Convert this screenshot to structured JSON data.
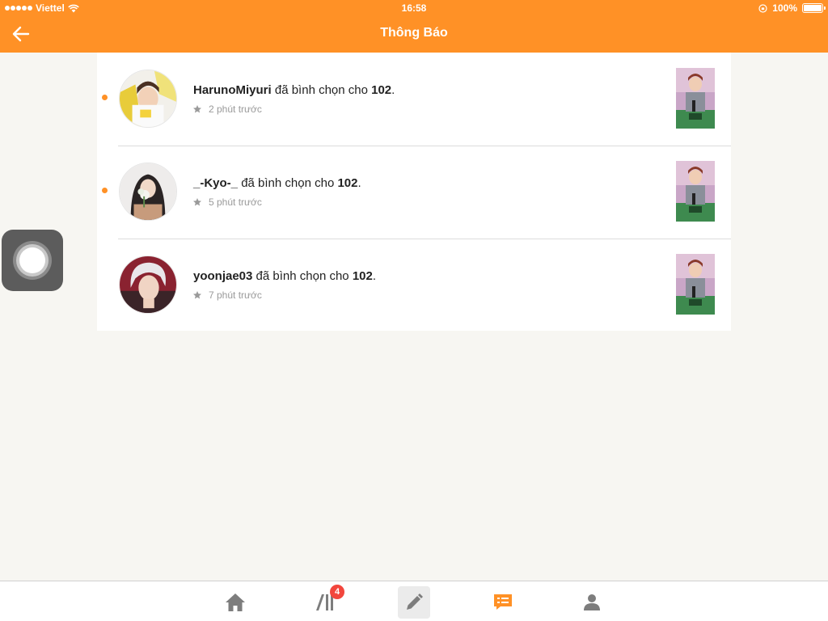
{
  "status_bar": {
    "carrier": "Viettel",
    "time": "16:58",
    "battery": "100%"
  },
  "header": {
    "title": "Thông Báo",
    "back_icon": "arrow-left-icon",
    "color": "#ff9126"
  },
  "notifications": [
    {
      "username": "HarunoMiyuri",
      "action": "đã bình chọn cho",
      "target": "102",
      "period": ".",
      "time": "2 phút trước",
      "unread": true
    },
    {
      "username": "_-Kyo-_",
      "action": "đã bình chọn cho",
      "target": "102",
      "period": ".",
      "time": "5 phút trước",
      "unread": true
    },
    {
      "username": "yoonjae03",
      "action": "đã bình chọn cho",
      "target": "102",
      "period": ".",
      "time": "7 phút trước",
      "unread": false
    }
  ],
  "tabbar": {
    "tabs": [
      {
        "name": "home",
        "icon": "home-icon"
      },
      {
        "name": "library",
        "icon": "library-icon",
        "badge": "4"
      },
      {
        "name": "write",
        "icon": "pencil-icon"
      },
      {
        "name": "notifications",
        "icon": "message-list-icon",
        "active": true
      },
      {
        "name": "profile",
        "icon": "user-icon"
      }
    ]
  },
  "colors": {
    "accent": "#ff9126",
    "badge": "#f2463d",
    "background": "#f7f6f2"
  }
}
